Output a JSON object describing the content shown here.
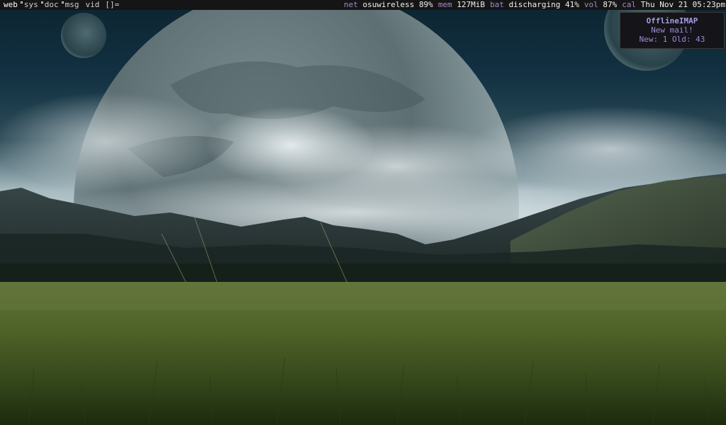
{
  "colors": {
    "bar_bg": "#151515",
    "label": "#a586d1",
    "value": "#f0f0f0",
    "notify_bg": "#141419",
    "notify_text": "#a188d6"
  },
  "topbar": {
    "tags": [
      {
        "label": "web",
        "active": true,
        "occupied": false
      },
      {
        "label": "sys",
        "active": false,
        "occupied": true
      },
      {
        "label": "doc",
        "active": false,
        "occupied": true
      },
      {
        "label": "msg",
        "active": false,
        "occupied": true
      },
      {
        "label": "vid",
        "active": false,
        "occupied": false
      }
    ],
    "layout_symbol": "[]=",
    "status": {
      "net_label": "net",
      "net_value": "osuwireless 89%",
      "mem_label": "mem",
      "mem_value": "127MiB",
      "bat_label": "bat",
      "bat_value": "discharging 41%",
      "vol_label": "vol",
      "vol_value": "87%",
      "cal_label": "cal",
      "cal_value": "Thu Nov 21 05:23pm"
    }
  },
  "notification": {
    "title": "OfflineIMAP",
    "line1": "New mail!",
    "line2": "New: 1 Old: 43"
  }
}
